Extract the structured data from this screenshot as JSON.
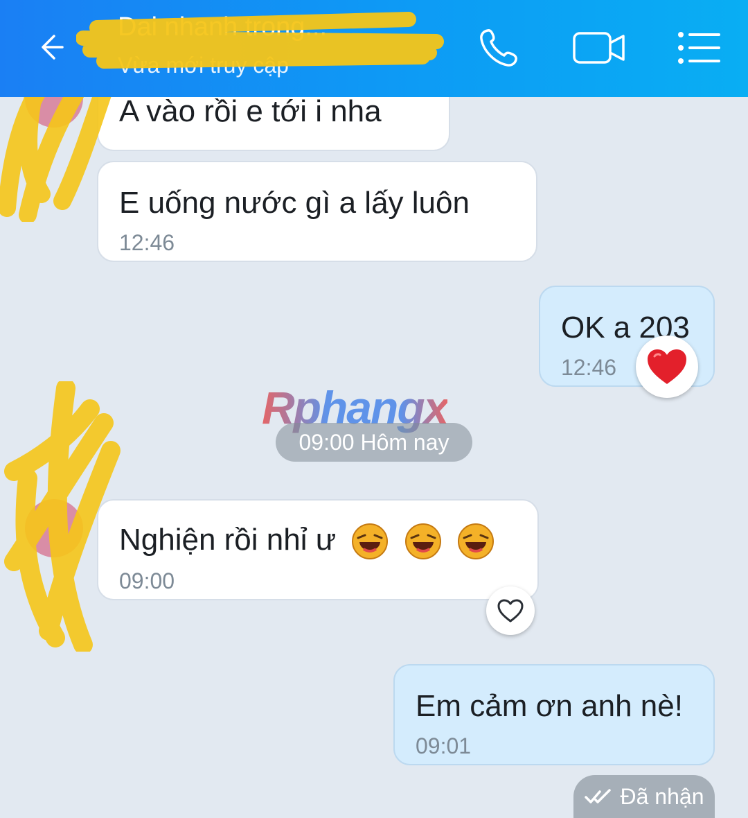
{
  "header": {
    "contact_name": "Dai nhanh trong...",
    "status": "Vừa mới truy cập",
    "background": "#1a7ff4"
  },
  "messages": [
    {
      "text": "A vào  rồi  e tới  i nha",
      "direction": "in"
    },
    {
      "text": "E uống nước  gì  a lấy  luôn",
      "time": "12:46",
      "direction": "in"
    },
    {
      "text": "OK a 203",
      "time": "12:46",
      "direction": "out",
      "reaction": "heart-emoji"
    },
    {
      "text": "Nghiện  rồi  nhỉ  ư",
      "time": "09:00",
      "direction": "in",
      "emoji": [
        "laughing-face-icon",
        "laughing-face-icon",
        "laughing-face-icon"
      ]
    },
    {
      "text": "Em cảm ơn anh nè!",
      "time": "09:01",
      "direction": "out"
    }
  ],
  "date_divider": "09:00 Hôm nay",
  "watermark": "Rphangx",
  "status_label": "Đã nhận",
  "colors": {
    "outgoing_bubble": "#d4ecfd",
    "incoming_bubble": "#ffffff",
    "chat_background": "#e2e9f1",
    "scribble": "#f5c518"
  }
}
